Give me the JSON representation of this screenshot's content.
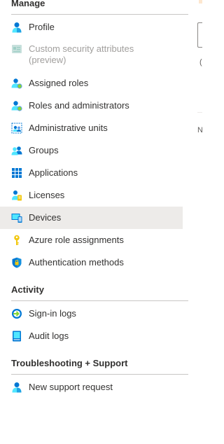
{
  "sections": {
    "manage": {
      "title": "Manage"
    },
    "activity": {
      "title": "Activity"
    },
    "troubleshooting": {
      "title": "Troubleshooting + Support"
    }
  },
  "manage_items": [
    {
      "label": "Profile",
      "icon": "profile-icon"
    },
    {
      "label": "Custom security attributes (preview)",
      "icon": "custom-security-attributes-icon",
      "disabled": true
    },
    {
      "label": "Assigned roles",
      "icon": "assigned-roles-icon"
    },
    {
      "label": "Roles and administrators",
      "icon": "roles-administrators-icon"
    },
    {
      "label": "Administrative units",
      "icon": "administrative-units-icon"
    },
    {
      "label": "Groups",
      "icon": "groups-icon"
    },
    {
      "label": "Applications",
      "icon": "applications-icon"
    },
    {
      "label": "Licenses",
      "icon": "licenses-icon"
    },
    {
      "label": "Devices",
      "icon": "devices-icon",
      "selected": true
    },
    {
      "label": "Azure role assignments",
      "icon": "key-icon"
    },
    {
      "label": "Authentication methods",
      "icon": "shield-icon"
    }
  ],
  "activity_items": [
    {
      "label": "Sign-in logs",
      "icon": "sign-in-logs-icon"
    },
    {
      "label": "Audit logs",
      "icon": "audit-logs-icon"
    }
  ],
  "support_items": [
    {
      "label": "New support request",
      "icon": "support-request-icon"
    }
  ],
  "peek": {
    "char_1": "(",
    "char_2": "N"
  },
  "colors": {
    "selected_bg": "#edebe9",
    "text": "#323130",
    "disabled_text": "#a19f9d",
    "azure_blue": "#0078d4"
  }
}
